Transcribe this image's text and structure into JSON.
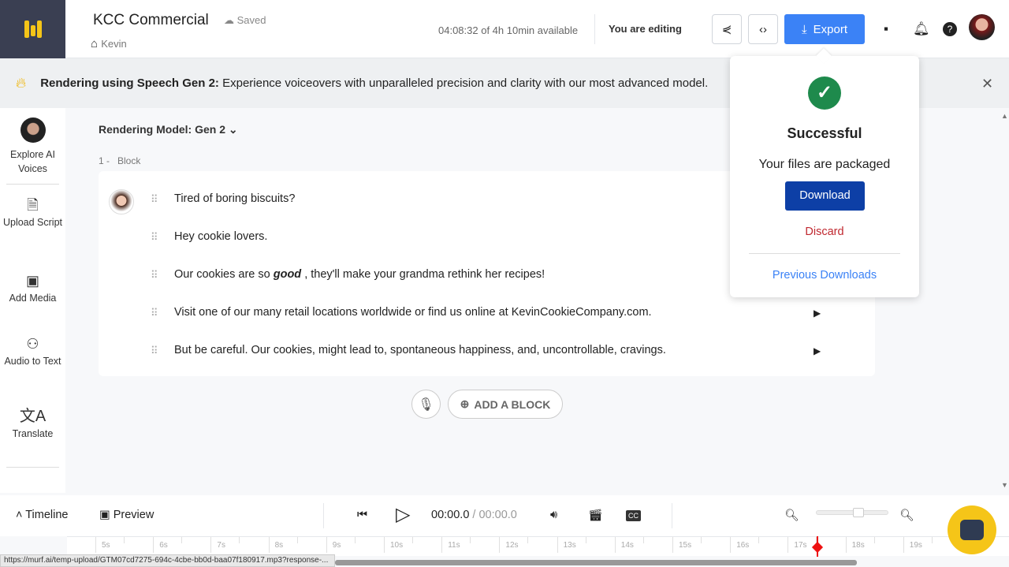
{
  "header": {
    "project_title": "KCC Commercial",
    "save_status": "Saved",
    "owner": "Kevin",
    "availability": "04:08:32 of 4h 10min available",
    "editing_status": "You are editing",
    "export_label": "Export"
  },
  "banner": {
    "bold": "Rendering using Speech Gen 2:",
    "text": " Experience voiceovers with unparalleled precision and clarity with our most advanced model."
  },
  "sidebar": {
    "items": [
      {
        "label": "Explore AI Voices",
        "icon": "voice-avatar"
      },
      {
        "label": "Upload Script",
        "icon": "upload-script-icon"
      },
      {
        "label": "Add Media",
        "icon": "media-icon"
      },
      {
        "label": "Audio to Text",
        "icon": "audio-to-text-icon"
      },
      {
        "label": "Translate",
        "icon": "translate-icon"
      }
    ]
  },
  "editor": {
    "model": "Rendering Model: Gen 2",
    "block_label": "1 -   Block",
    "lines": [
      {
        "pre": "Tired of boring biscuits?",
        "em": "",
        "post": ""
      },
      {
        "pre": "Hey cookie lovers.",
        "em": "",
        "post": ""
      },
      {
        "pre": "Our cookies are so ",
        "em": "good",
        "post": " , they'll make your grandma rethink her recipes!"
      },
      {
        "pre": "Visit one of our many retail locations worldwide or find us online at KevinCookieCompany.com.",
        "em": "",
        "post": ""
      },
      {
        "pre": "But be careful. Our cookies, might lead to, spontaneous happiness, and, uncontrollable, cravings.",
        "em": "",
        "post": ""
      }
    ],
    "add_block": "ADD A BLOCK"
  },
  "popup": {
    "title": "Successful",
    "message": "Your files are packaged",
    "download": "Download",
    "discard": "Discard",
    "previous": "Previous Downloads"
  },
  "player": {
    "timeline": "Timeline",
    "preview": "Preview",
    "current": "00:00.0",
    "total": "/ 00:00.0",
    "zoom_level": 0.55
  },
  "ruler": {
    "ticks": [
      "5s",
      "6s",
      "7s",
      "8s",
      "9s",
      "10s",
      "11s",
      "12s",
      "13s",
      "14s",
      "15s",
      "16s",
      "17s",
      "18s",
      "19s"
    ]
  },
  "status_url": "https://murf.ai/temp-upload/GTM07cd7275-694c-4cbe-bb0d-baa07f180917.mp3?response-...",
  "colors": {
    "accent": "#3b82f6",
    "download": "#0d3fa6",
    "success": "#1e8a4c",
    "discard": "#c0282f",
    "logo": "#f5c518"
  }
}
